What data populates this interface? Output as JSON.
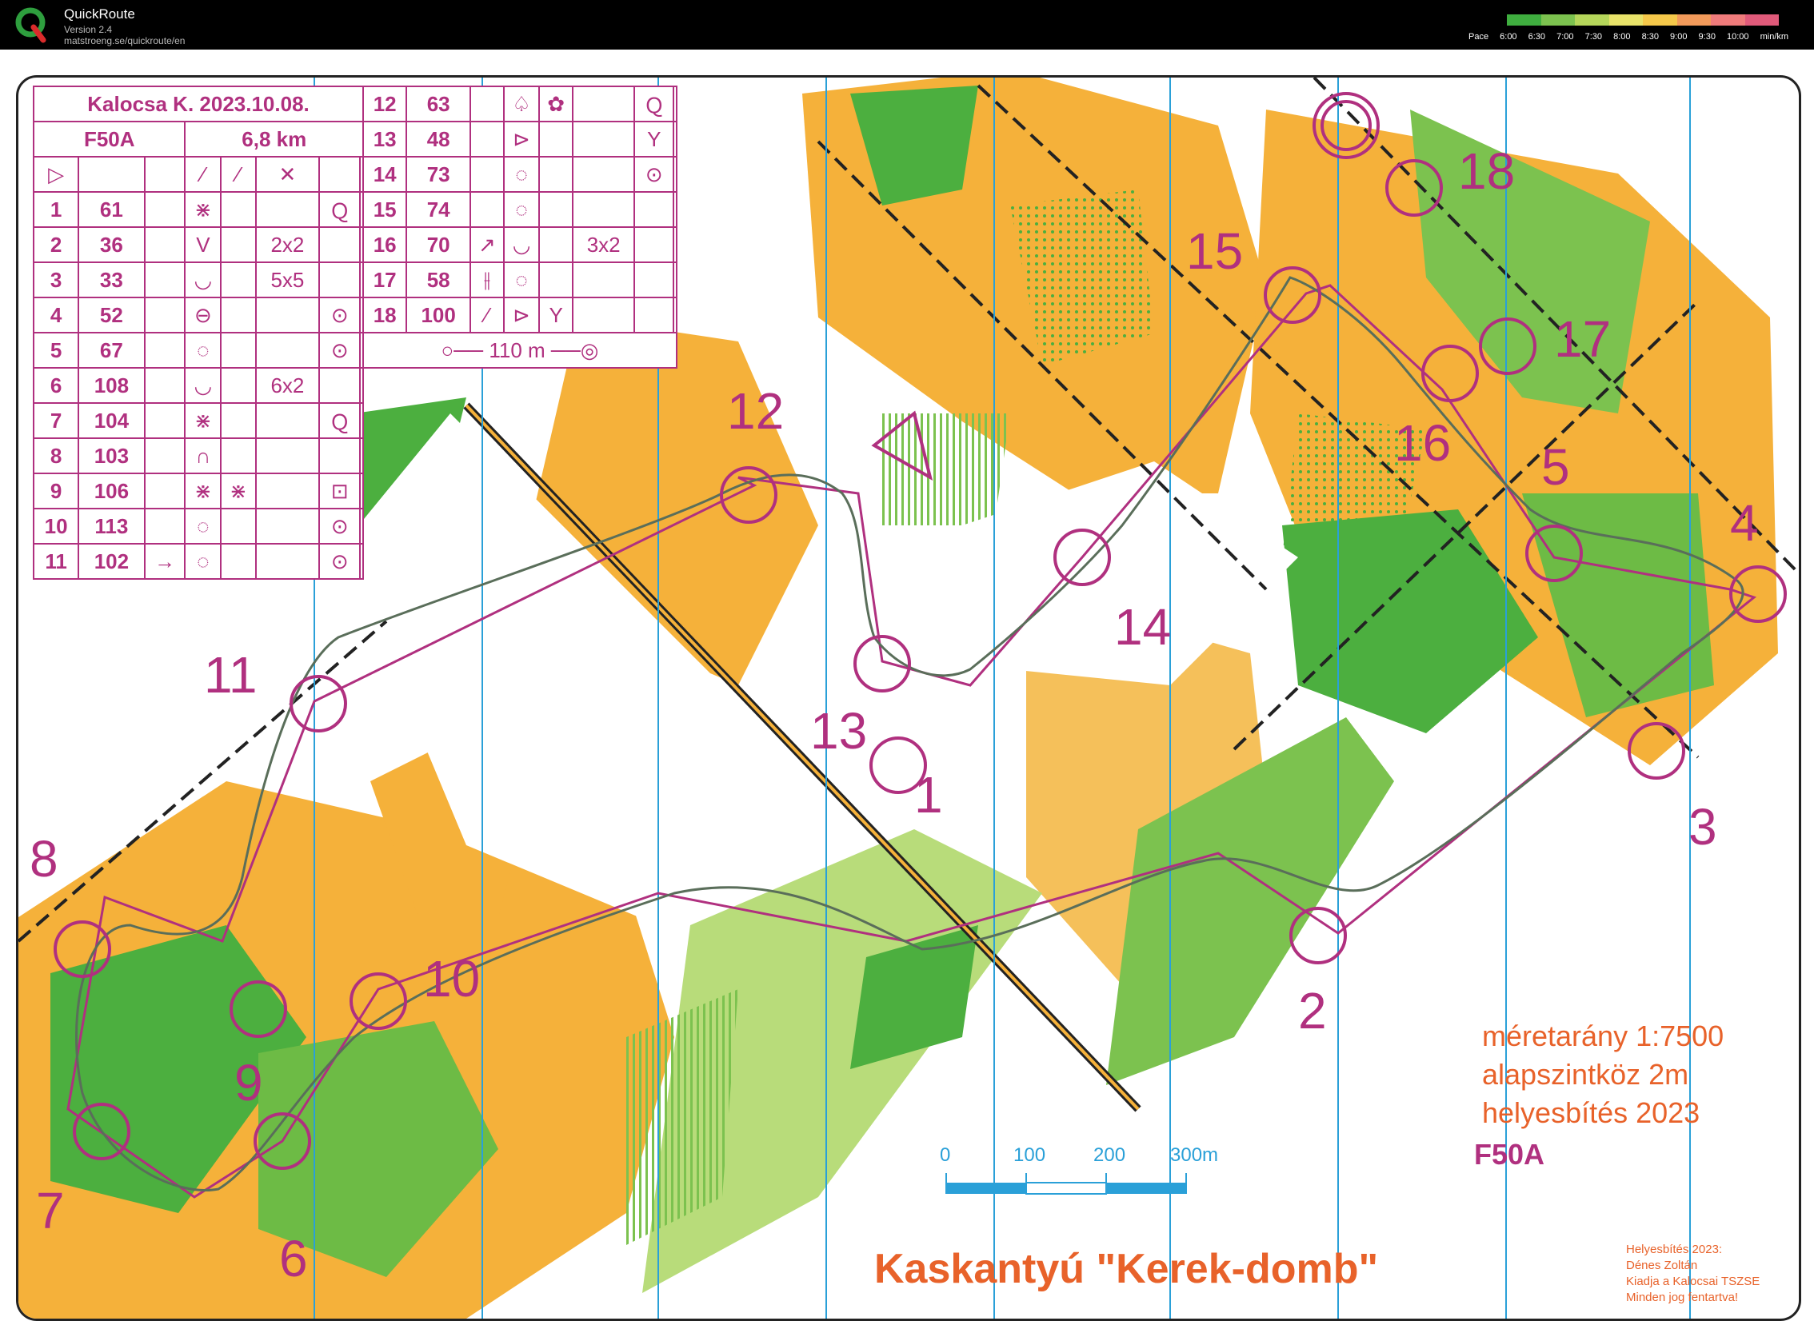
{
  "app": {
    "name": "QuickRoute",
    "version": "Version 2.4",
    "url": "matstroeng.se/quickroute/en"
  },
  "pace_legend": {
    "label": "Pace",
    "ticks": [
      "6:00",
      "6:30",
      "7:00",
      "7:30",
      "8:00",
      "8:30",
      "9:00",
      "9:30",
      "10:00"
    ],
    "unit": "min/km",
    "colors": [
      "#3fae3f",
      "#7cc24f",
      "#b5d65a",
      "#e8e36a",
      "#f5c84a",
      "#f29a5a",
      "#ef7b7b",
      "#e05a7a"
    ]
  },
  "description": {
    "event": "Kalocsa K. 2023.10.08.",
    "course": "F50A",
    "length": "6,8 km",
    "start_symbol": "▷",
    "header_symbols": [
      "⁄",
      "⁄",
      "✕"
    ],
    "controls": [
      {
        "num": "1",
        "code": "61",
        "c": "⋇",
        "d": "",
        "f": "",
        "g": "Ｑ"
      },
      {
        "num": "2",
        "code": "36",
        "c": "V",
        "d": "",
        "f": "2x2",
        "g": ""
      },
      {
        "num": "3",
        "code": "33",
        "c": "◡",
        "d": "",
        "f": "5x5",
        "g": ""
      },
      {
        "num": "4",
        "code": "52",
        "c": "⊖",
        "d": "",
        "f": "",
        "g": "⊙"
      },
      {
        "num": "5",
        "code": "67",
        "c": "◌",
        "d": "",
        "f": "",
        "g": "⊙"
      },
      {
        "num": "6",
        "code": "108",
        "c": "◡",
        "d": "",
        "f": "6x2",
        "g": ""
      },
      {
        "num": "7",
        "code": "104",
        "c": "⋇",
        "d": "",
        "f": "",
        "g": "Ｑ"
      },
      {
        "num": "8",
        "code": "103",
        "c": "∩",
        "d": "",
        "f": "",
        "g": ""
      },
      {
        "num": "9",
        "code": "106",
        "c": "⋇",
        "d": "⋇",
        "f": "",
        "g": "⊡"
      },
      {
        "num": "10",
        "code": "113",
        "c": "◌",
        "d": "",
        "f": "",
        "g": "⊙"
      },
      {
        "num": "11",
        "code": "102",
        "b": "→",
        "c": "◌",
        "d": "",
        "f": "",
        "g": "⊙"
      },
      {
        "num": "12",
        "code": "63",
        "c": "♤",
        "d": "✿",
        "f": "",
        "g": "Ｑ"
      },
      {
        "num": "13",
        "code": "48",
        "c": "⊳",
        "d": "",
        "f": "",
        "g": "Y"
      },
      {
        "num": "14",
        "code": "73",
        "c": "◌",
        "d": "",
        "f": "",
        "g": "⊙"
      },
      {
        "num": "15",
        "code": "74",
        "c": "◌",
        "d": "",
        "f": "",
        "g": ""
      },
      {
        "num": "16",
        "code": "70",
        "b": "↗",
        "c": "◡",
        "d": "",
        "f": "3x2",
        "g": ""
      },
      {
        "num": "17",
        "code": "58",
        "b": "⫲",
        "c": "◌",
        "d": "",
        "f": "",
        "g": ""
      },
      {
        "num": "18",
        "code": "100",
        "b": "⁄",
        "c": "⊳",
        "d": "Y",
        "f": "",
        "g": ""
      }
    ],
    "finish_distance": "110 m"
  },
  "map_labels": {
    "n1": "1",
    "n2": "2",
    "n3": "3",
    "n4": "4",
    "n5": "5",
    "n6": "6",
    "n7": "7",
    "n8": "8",
    "n9": "9",
    "n10": "10",
    "n11": "11",
    "n12": "12",
    "n13": "13",
    "n14": "14",
    "n15": "15",
    "n16": "16",
    "n17": "17",
    "n18": "18"
  },
  "map_info": {
    "scale": "méretarány  1:7500",
    "contour": "alapszintköz  2m",
    "updated": "helyesbítés  2023",
    "course": "F50A",
    "title": "Kaskantyú \"Kerek-domb\"",
    "credit_lines": [
      "Helyesbítés 2023:",
      "Dénes Zoltán",
      "Kiadja a Kalocsai TSZSE",
      "Minden jog fentartva!"
    ]
  },
  "scalebar": {
    "ticks": [
      "0",
      "100",
      "200",
      "300m"
    ]
  },
  "colors": {
    "course": "#b0307f",
    "forest": "#4caf3f",
    "light_green": "#b8dc7a",
    "open": "#f5a623",
    "route": "#5a6e5a",
    "magnetic": "#2aa0d8"
  }
}
